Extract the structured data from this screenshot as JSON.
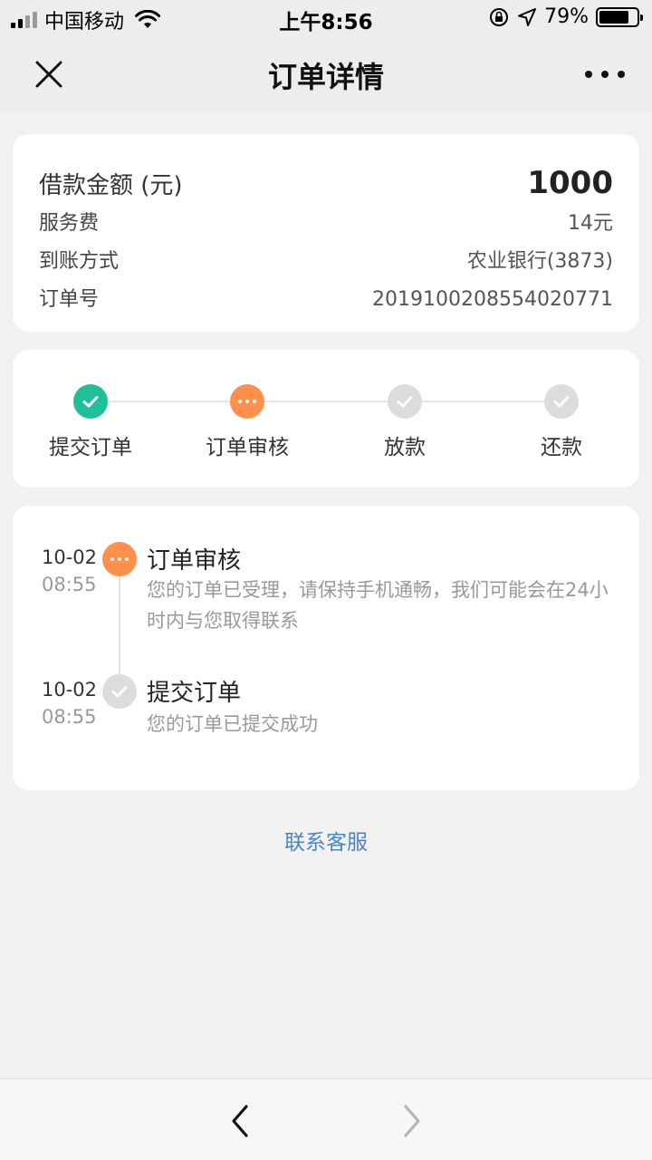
{
  "status_bar": {
    "carrier": "中国移动",
    "time": "上午8:56",
    "battery_text": "79%",
    "battery_level": 0.79
  },
  "nav": {
    "title": "订单详情",
    "close_icon": "close-icon",
    "more_icon": "more-dots-icon"
  },
  "summary": {
    "amount_label": "借款金额 (元)",
    "amount_value": "1000",
    "fee_label": "服务费",
    "fee_value": "14元",
    "method_label": "到账方式",
    "method_value": "农业银行(3873)",
    "order_label": "订单号",
    "order_value": "20191002085540207​71"
  },
  "steps": [
    {
      "label": "提交订单",
      "state": "done"
    },
    {
      "label": "订单审核",
      "state": "active"
    },
    {
      "label": "放款",
      "state": "todo"
    },
    {
      "label": "还款",
      "state": "todo"
    }
  ],
  "timeline": [
    {
      "date": "10-02",
      "time": "08:55",
      "title": "订单审核",
      "desc": "您的订单已受理，请保持手机通畅，我们可能会在24小时内与您取得联系",
      "state": "active"
    },
    {
      "date": "10-02",
      "time": "08:55",
      "title": "提交订单",
      "desc": "您的订单已提交成功",
      "state": "todo"
    }
  ],
  "contact_label": "联系客服",
  "colors": {
    "done": "#1fbf99",
    "active": "#ff8f4d",
    "todo": "#dcdcdc",
    "link": "#4a86c5"
  }
}
